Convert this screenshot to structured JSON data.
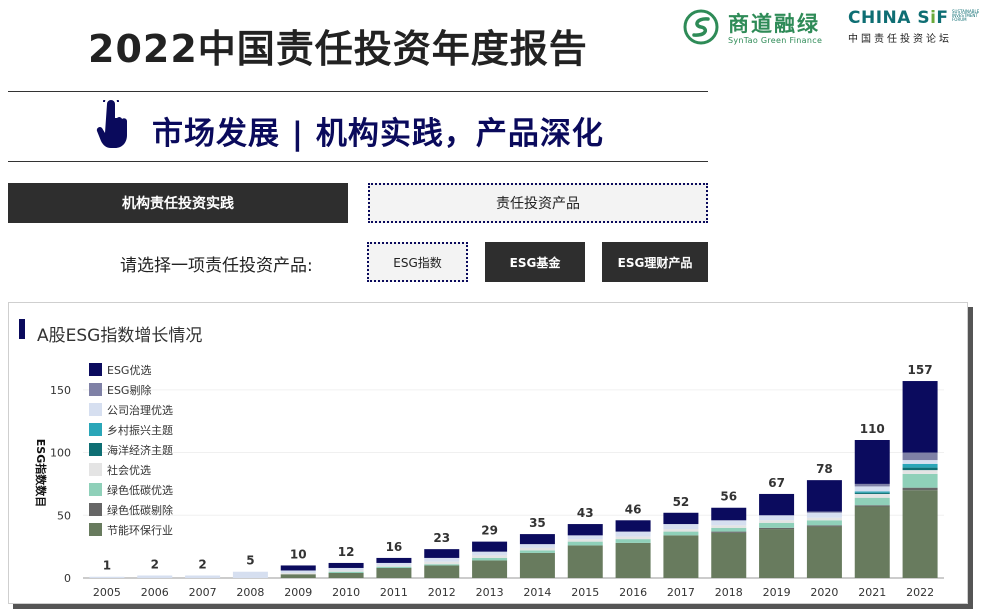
{
  "header": {
    "title": "2022中国责任投资年度报告",
    "subtitle": "市场发展 | 机构实践，产品深化",
    "logo_syntao_cn": "商道融绿",
    "logo_syntao_en": "SynTao Green Finance",
    "logo_sif_en_a": "CHINA S",
    "logo_sif_en_b": "i",
    "logo_sif_en_c": "F",
    "logo_sif_tiny": "SUSTAINABLE INVESTMENT FORUM",
    "logo_sif_cn": "中国责任投资论坛"
  },
  "tabs": {
    "institution": "机构责任投资实践",
    "products": "责任投资产品"
  },
  "product_select": {
    "label": "请选择一项责任投资产品:",
    "esg_index": "ESG指数",
    "esg_fund": "ESG基金",
    "esg_wealth": "ESG理财产品"
  },
  "chart_title": "A股ESG指数增长情况",
  "colors": {
    "accent": "#0a0a5c",
    "dark_button": "#2e2e2e"
  },
  "chart_data": {
    "type": "bar",
    "stacked": true,
    "title": "A股ESG指数增长情况",
    "ylabel": "ESG指数数目",
    "xlabel": "",
    "ylim": [
      0,
      165
    ],
    "yticks": [
      0,
      50,
      100,
      150
    ],
    "categories": [
      "2005",
      "2006",
      "2007",
      "2008",
      "2009",
      "2010",
      "2011",
      "2012",
      "2013",
      "2014",
      "2015",
      "2016",
      "2017",
      "2018",
      "2019",
      "2020",
      "2021",
      "2022"
    ],
    "totals": [
      1,
      2,
      2,
      5,
      10,
      12,
      16,
      23,
      29,
      35,
      43,
      46,
      52,
      56,
      67,
      78,
      110,
      157
    ],
    "legend_position": "top-left",
    "series": [
      {
        "name": "ESG优选",
        "color": "#0b0b5e",
        "values": [
          0,
          0,
          0,
          0,
          4,
          4,
          4,
          7,
          8,
          8,
          9,
          9,
          9,
          10,
          17,
          25,
          35,
          57
        ]
      },
      {
        "name": "ESG剔除",
        "color": "#7f81a6",
        "values": [
          0,
          0,
          0,
          0,
          0,
          0,
          0,
          0,
          0,
          0,
          0,
          0,
          0,
          0,
          0,
          1,
          2,
          6
        ]
      },
      {
        "name": "公司治理优选",
        "color": "#d6dff0",
        "values": [
          1,
          2,
          2,
          5,
          2,
          2,
          2,
          3,
          3,
          3,
          3,
          4,
          4,
          4,
          4,
          4,
          4,
          3
        ]
      },
      {
        "name": "乡村振兴主题",
        "color": "#2aa6b8",
        "values": [
          0,
          0,
          0,
          0,
          0,
          0,
          0,
          0,
          0,
          0,
          0,
          0,
          0,
          0,
          0,
          0,
          1,
          3
        ]
      },
      {
        "name": "海洋经济主题",
        "color": "#0e6e73",
        "values": [
          0,
          0,
          0,
          0,
          0,
          0,
          0,
          0,
          0,
          0,
          0,
          0,
          0,
          0,
          0,
          0,
          1,
          2
        ]
      },
      {
        "name": "社会优选",
        "color": "#e4e4e4",
        "values": [
          0,
          0,
          0,
          0,
          1,
          1,
          1,
          2,
          2,
          2,
          2,
          2,
          2,
          2,
          2,
          2,
          3,
          3
        ]
      },
      {
        "name": "绿色低碳优选",
        "color": "#8fd0b9",
        "values": [
          0,
          0,
          0,
          0,
          0,
          1,
          1,
          1,
          2,
          2,
          3,
          3,
          3,
          3,
          4,
          4,
          6,
          11
        ]
      },
      {
        "name": "绿色低碳剔除",
        "color": "#666666",
        "values": [
          0,
          0,
          0,
          0,
          0,
          0,
          0,
          0,
          0,
          0,
          0,
          0,
          0,
          1,
          1,
          1,
          1,
          2
        ]
      },
      {
        "name": "节能环保行业",
        "color": "#687b5e",
        "values": [
          0,
          0,
          0,
          0,
          3,
          4,
          8,
          10,
          14,
          20,
          26,
          28,
          34,
          36,
          39,
          41,
          57,
          70
        ]
      }
    ]
  }
}
